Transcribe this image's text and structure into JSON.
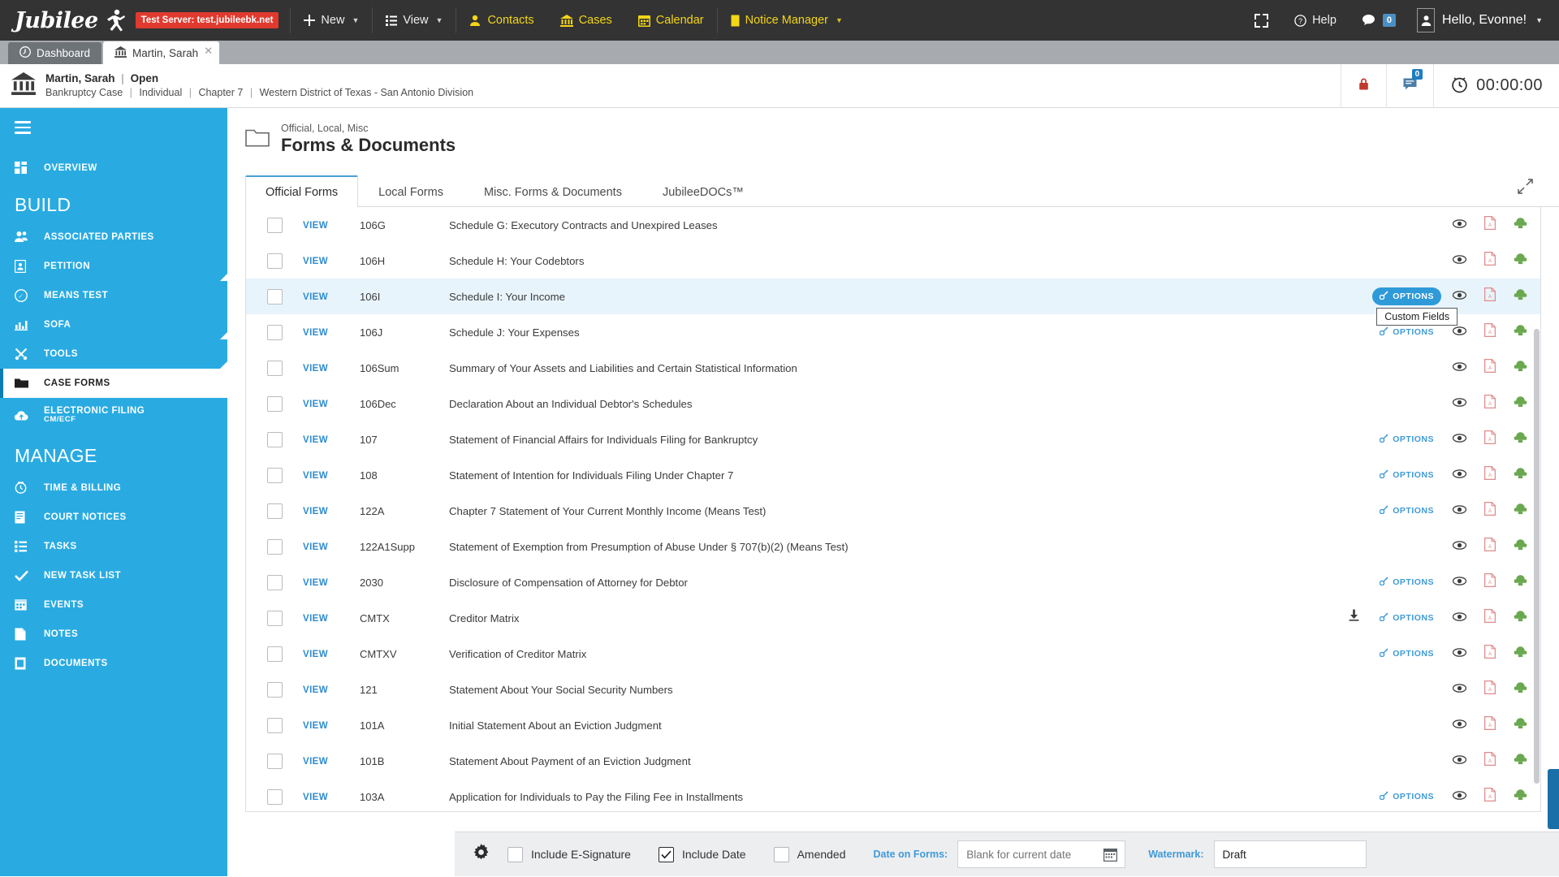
{
  "topnav": {
    "brand": "Jubilee",
    "test_badge": "Test Server: test.jubileebk.net",
    "items": [
      {
        "label": "New",
        "icon": "plus-icon",
        "caret": true
      },
      {
        "label": "View",
        "icon": "list-icon",
        "caret": true
      },
      {
        "label": "Contacts",
        "icon": "contacts-icon",
        "caret": false
      },
      {
        "label": "Cases",
        "icon": "bank-icon",
        "caret": false
      },
      {
        "label": "Calendar",
        "icon": "calendar-icon",
        "caret": false
      },
      {
        "label": "Notice Manager",
        "icon": "notice-icon",
        "caret": true
      }
    ],
    "help": "Help",
    "chat_count": "0",
    "user_greeting": "Hello, Evonne!"
  },
  "window_tabs": [
    {
      "label": "Dashboard",
      "icon": "dashboard-icon",
      "active": false,
      "closable": false
    },
    {
      "label": "Martin, Sarah",
      "icon": "bank-icon",
      "active": true,
      "closable": true
    }
  ],
  "casebar": {
    "name": "Martin, Sarah",
    "status": "Open",
    "type": "Bankruptcy Case",
    "debtor_type": "Individual",
    "chapter": "Chapter 7",
    "district": "Western District of Texas - San Antonio Division",
    "notes_badge": "0",
    "timer": "00:00:00"
  },
  "sidebar": {
    "overview": {
      "label": "OVERVIEW",
      "icon": "grid-icon"
    },
    "groups": [
      {
        "title": "BUILD",
        "items": [
          {
            "label": "ASSOCIATED PARTIES",
            "icon": "parties-icon",
            "corner": false,
            "active": false
          },
          {
            "label": "PETITION",
            "icon": "petition-icon",
            "corner": true,
            "active": false
          },
          {
            "label": "MEANS TEST",
            "icon": "meanstest-icon",
            "corner": false,
            "active": false
          },
          {
            "label": "SOFA",
            "icon": "sofa-icon",
            "corner": true,
            "active": false
          },
          {
            "label": "TOOLS",
            "icon": "tools-icon",
            "corner": true,
            "active": false
          },
          {
            "label": "CASE FORMS",
            "icon": "folder-icon",
            "corner": false,
            "active": true
          },
          {
            "label": "ELECTRONIC FILING",
            "sub": "CM/ECF",
            "icon": "upload-icon",
            "corner": false,
            "active": false
          }
        ]
      },
      {
        "title": "MANAGE",
        "items": [
          {
            "label": "TIME & BILLING",
            "icon": "clock-icon",
            "corner": false,
            "active": false
          },
          {
            "label": "COURT NOTICES",
            "icon": "doc-icon",
            "corner": false,
            "active": false
          },
          {
            "label": "TASKS",
            "icon": "list-icon",
            "corner": false,
            "active": false
          },
          {
            "label": "NEW TASK LIST",
            "icon": "check-icon",
            "corner": false,
            "active": false
          },
          {
            "label": "EVENTS",
            "icon": "calendar-icon",
            "corner": false,
            "active": false
          },
          {
            "label": "NOTES",
            "icon": "note-icon",
            "corner": false,
            "active": false
          },
          {
            "label": "DOCUMENTS",
            "icon": "documents-icon",
            "corner": false,
            "active": false
          }
        ]
      }
    ]
  },
  "page": {
    "breadcrumb": "Official, Local, Misc",
    "title": "Forms & Documents",
    "tabs": [
      {
        "label": "Official Forms",
        "active": true
      },
      {
        "label": "Local Forms",
        "active": false
      },
      {
        "label": "Misc. Forms & Documents",
        "active": false
      },
      {
        "label": "JubileeDOCs™",
        "active": false
      }
    ]
  },
  "table": {
    "view_label": "VIEW",
    "options_label": "OPTIONS",
    "tooltip": "Custom Fields",
    "rows": [
      {
        "code": "106G",
        "name": "Schedule G: Executory Contracts and Unexpired Leases",
        "options": false,
        "download": false,
        "highlight": false
      },
      {
        "code": "106H",
        "name": "Schedule H: Your Codebtors",
        "options": false,
        "download": false,
        "highlight": false
      },
      {
        "code": "106I",
        "name": "Schedule I: Your Income",
        "options": true,
        "download": false,
        "highlight": true
      },
      {
        "code": "106J",
        "name": "Schedule J: Your Expenses",
        "options": true,
        "download": false,
        "highlight": false
      },
      {
        "code": "106Sum",
        "name": "Summary of Your Assets and Liabilities and Certain Statistical Information",
        "options": false,
        "download": false,
        "highlight": false
      },
      {
        "code": "106Dec",
        "name": "Declaration About an Individual Debtor's Schedules",
        "options": false,
        "download": false,
        "highlight": false
      },
      {
        "code": "107",
        "name": "Statement of Financial Affairs for Individuals Filing for Bankruptcy",
        "options": true,
        "download": false,
        "highlight": false
      },
      {
        "code": "108",
        "name": "Statement of Intention for Individuals Filing Under Chapter 7",
        "options": true,
        "download": false,
        "highlight": false
      },
      {
        "code": "122A",
        "name": "Chapter 7 Statement of Your Current Monthly Income (Means Test)",
        "options": true,
        "download": false,
        "highlight": false
      },
      {
        "code": "122A1Supp",
        "name": "Statement of Exemption from Presumption of Abuse Under § 707(b)(2) (Means Test)",
        "options": false,
        "download": false,
        "highlight": false
      },
      {
        "code": "2030",
        "name": "Disclosure of Compensation of Attorney for Debtor",
        "options": true,
        "download": false,
        "highlight": false
      },
      {
        "code": "CMTX",
        "name": "Creditor Matrix",
        "options": true,
        "download": true,
        "highlight": false
      },
      {
        "code": "CMTXV",
        "name": "Verification of Creditor Matrix",
        "options": true,
        "download": false,
        "highlight": false
      },
      {
        "code": "121",
        "name": "Statement About Your Social Security Numbers",
        "options": false,
        "download": false,
        "highlight": false
      },
      {
        "code": "101A",
        "name": "Initial Statement About an Eviction Judgment",
        "options": false,
        "download": false,
        "highlight": false
      },
      {
        "code": "101B",
        "name": "Statement About Payment of an Eviction Judgment",
        "options": false,
        "download": false,
        "highlight": false
      },
      {
        "code": "103A",
        "name": "Application for Individuals to Pay the Filing Fee in Installments",
        "options": true,
        "download": false,
        "highlight": false
      }
    ]
  },
  "bottombar": {
    "esignature_label": "Include E-Signature",
    "esignature_checked": false,
    "date_label": "Include Date",
    "date_checked": true,
    "amended_label": "Amended",
    "amended_checked": false,
    "date_on_forms_label": "Date on Forms:",
    "date_on_forms_placeholder": "Blank for current date",
    "date_on_forms_value": "",
    "watermark_label": "Watermark:",
    "watermark_value": "Draft"
  },
  "colors": {
    "brand_blue": "#29abe2",
    "nav_dark": "#333333",
    "accent_link": "#2e8bd0",
    "danger": "#e03a2f",
    "pdf_red": "#e08b8b",
    "print_green": "#6aa84f"
  }
}
